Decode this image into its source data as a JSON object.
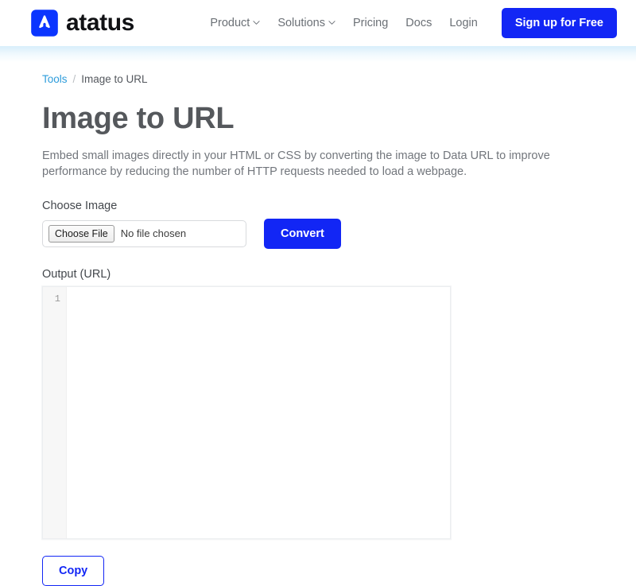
{
  "header": {
    "brand_name": "atatus",
    "logo_icon": "atatus-arrow-logo",
    "nav": [
      {
        "label": "Product",
        "has_caret": true,
        "icon": "chevron-down-icon"
      },
      {
        "label": "Solutions",
        "has_caret": true,
        "icon": "chevron-down-icon"
      },
      {
        "label": "Pricing",
        "has_caret": false
      },
      {
        "label": "Docs",
        "has_caret": false
      },
      {
        "label": "Login",
        "has_caret": false
      }
    ],
    "cta_label": "Sign up for Free",
    "accent_color": "#1226f5",
    "glow_color": "#d8eefb"
  },
  "breadcrumb": {
    "root_label": "Tools",
    "separator": "/",
    "current_label": "Image to URL",
    "link_color": "#2d9cdb"
  },
  "main": {
    "title": "Image to URL",
    "description": "Embed small images directly in your HTML or CSS by converting the image to Data URL to improve performance by reducing the number of HTTP requests needed to load a webpage.",
    "upload": {
      "label": "Choose Image",
      "file_button_label": "Choose File",
      "file_status": "No file chosen",
      "convert_label": "Convert"
    },
    "output": {
      "label": "Output (URL)",
      "line_numbers": [
        "1"
      ],
      "value": "",
      "copy_label": "Copy"
    }
  }
}
